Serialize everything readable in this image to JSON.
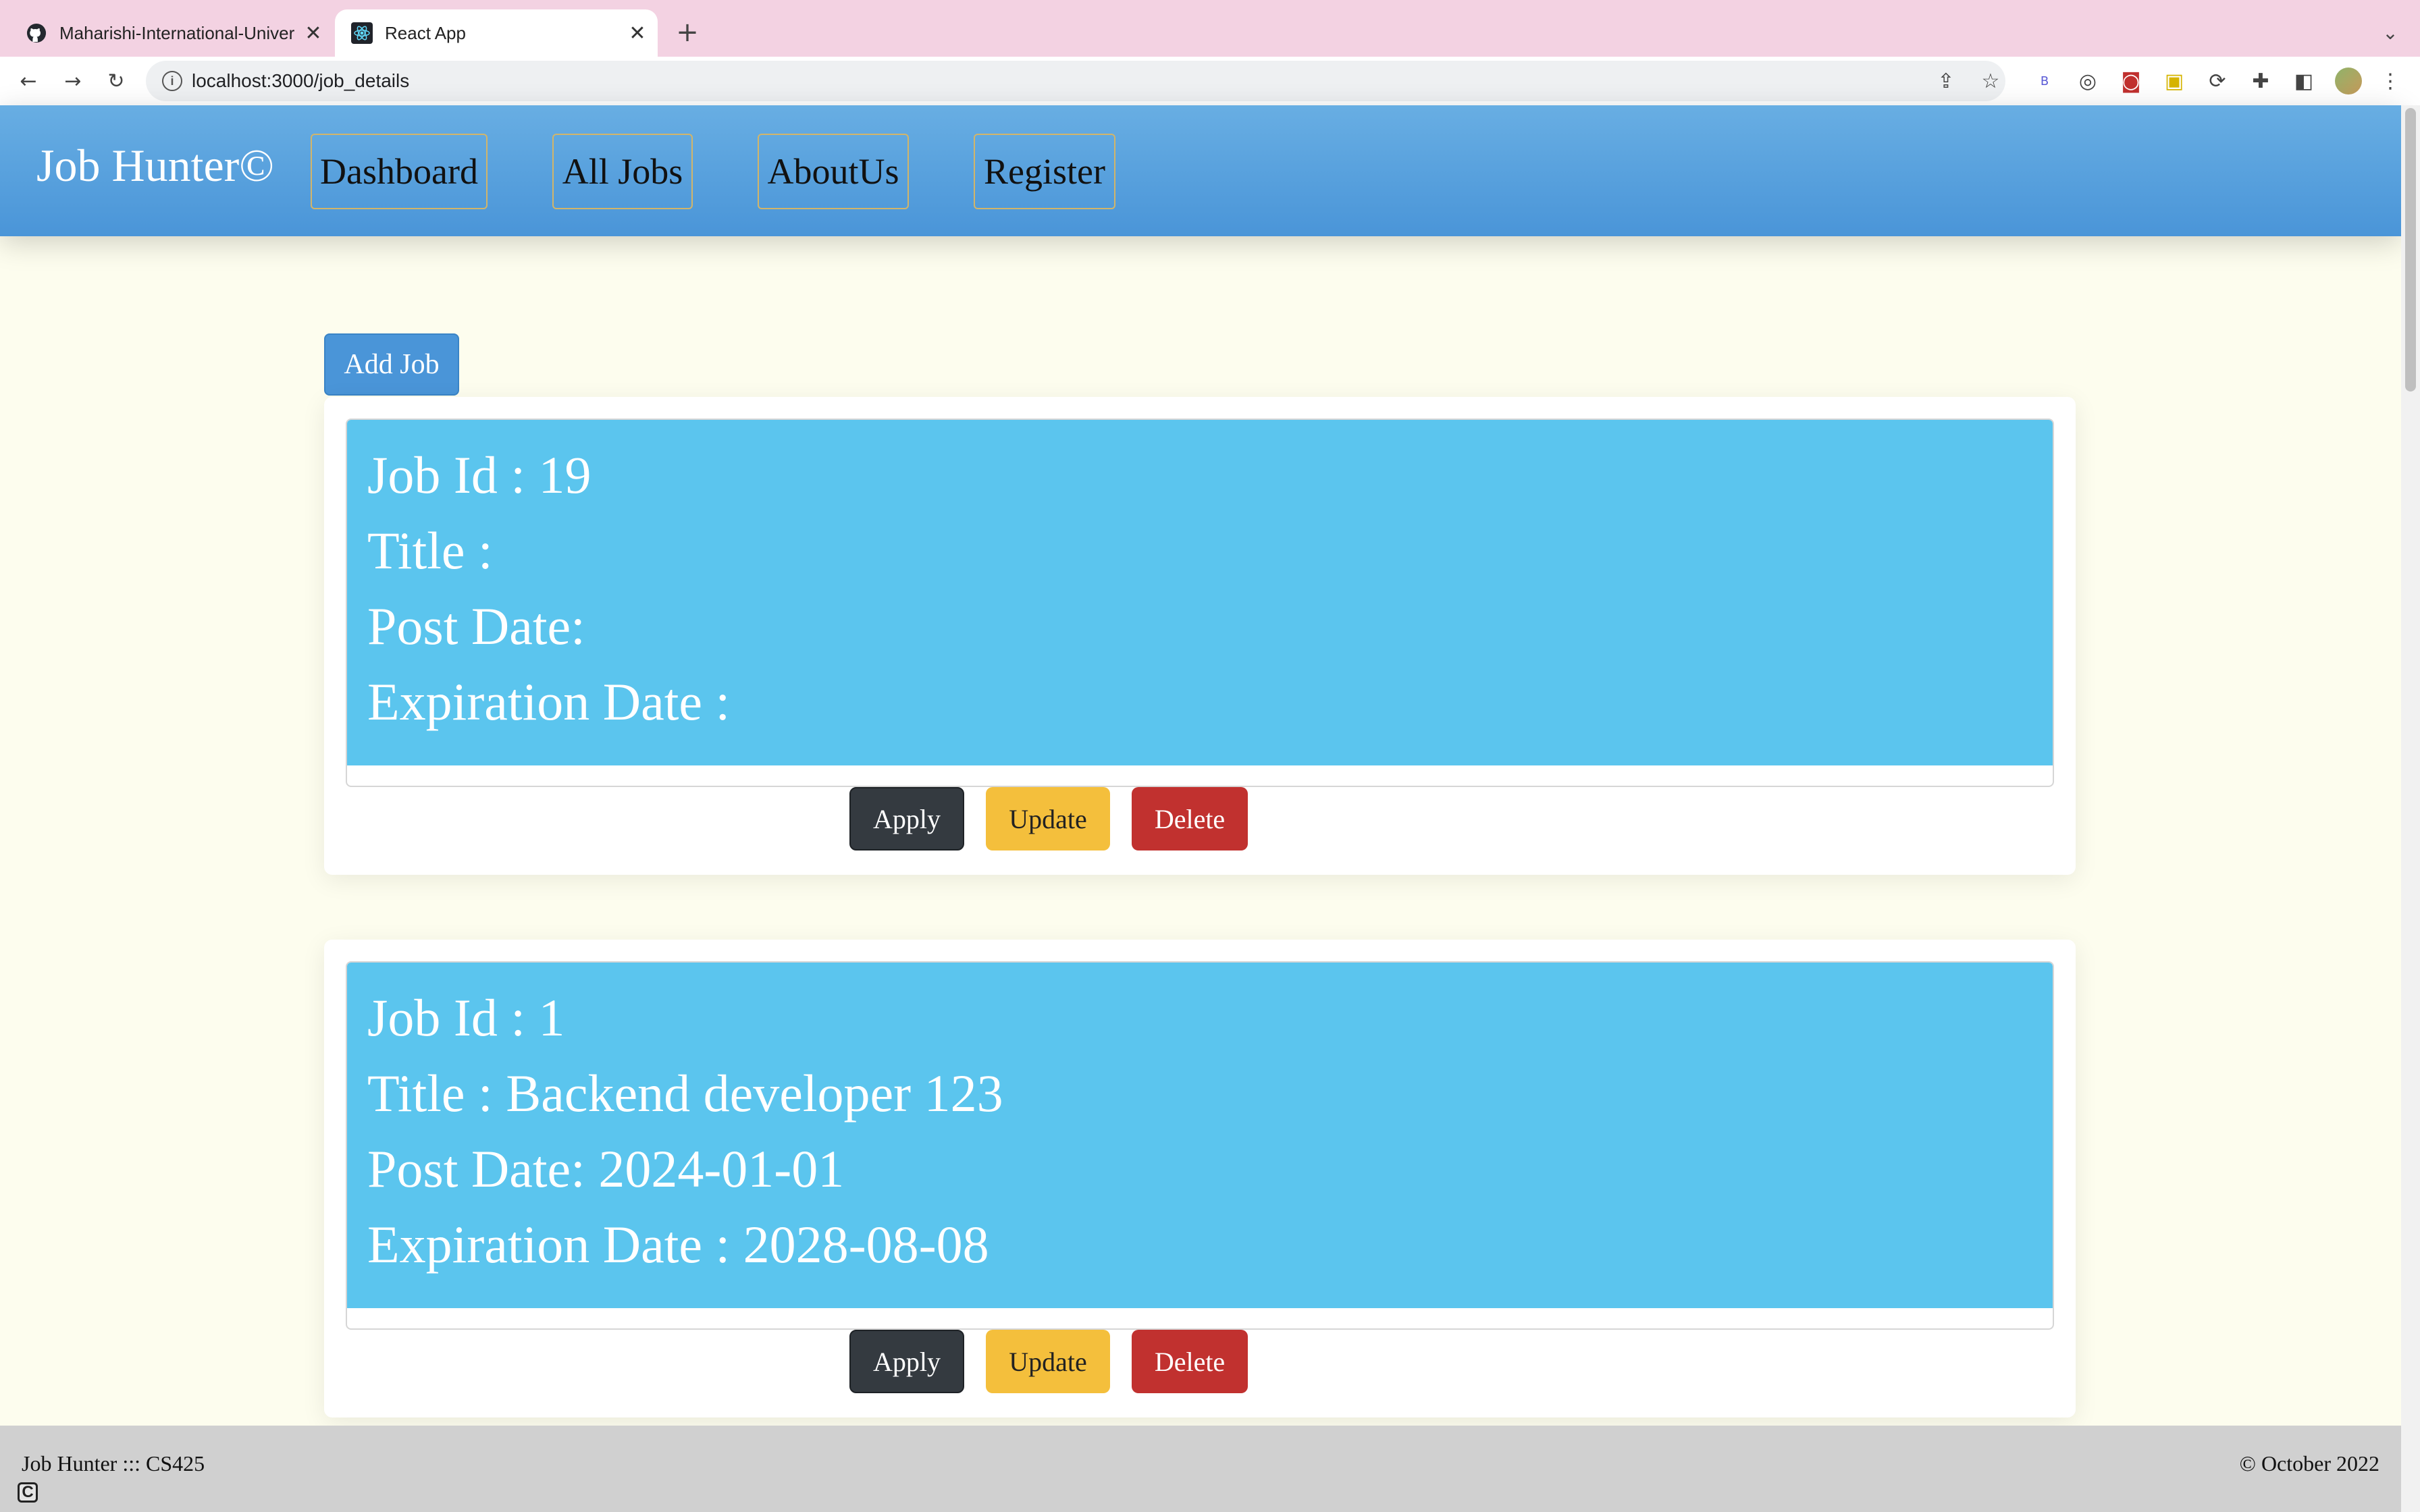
{
  "browser": {
    "tabs": [
      {
        "title": "Maharishi-International-Univer",
        "icon": "github-icon"
      },
      {
        "title": "React App",
        "icon": "react-icon",
        "active": true
      }
    ],
    "new_tab_label": "+",
    "url": "localhost:3000/job_details"
  },
  "app": {
    "brand": "Job Hunter©",
    "nav": [
      "Dashboard",
      "All Jobs",
      "AboutUs",
      "Register"
    ],
    "add_job_label": "Add Job"
  },
  "jobs": [
    {
      "id_label": "Job Id : ",
      "id": "19",
      "title_label": "Title : ",
      "title": "",
      "post_label": "Post Date: ",
      "post_date": "",
      "exp_label": "Expiration Date : ",
      "exp_date": ""
    },
    {
      "id_label": "Job Id : ",
      "id": "1",
      "title_label": "Title : ",
      "title": "Backend developer 123",
      "post_label": "Post Date: ",
      "post_date": "2024-01-01",
      "exp_label": "Expiration Date : ",
      "exp_date": "2028-08-08"
    }
  ],
  "actions": {
    "apply": "Apply",
    "update": "Update",
    "delete": "Delete"
  },
  "footer": {
    "left": "Job Hunter ::: CS425",
    "right": "© October 2022",
    "badge": "C"
  },
  "colors": {
    "header": "#4a95d8",
    "card_blue": "#5bc5ee",
    "apply": "#343a40",
    "update": "#f4bf3c",
    "delete": "#c1312f",
    "page_bg": "#fdfdee"
  }
}
